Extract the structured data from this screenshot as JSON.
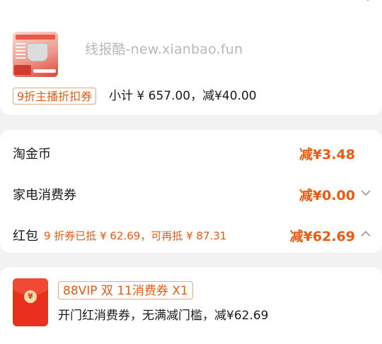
{
  "watermark": "线报酷-new.xianbao.fun",
  "product": {
    "coupon_tag": "9折主播折扣券",
    "subtotal_text": "小计 ¥ 657.00，减¥40.00"
  },
  "discounts": [
    {
      "label": "淘金币",
      "value": "减¥3.48",
      "chevron": "none"
    },
    {
      "label": "家电消费券",
      "value": "减¥0.00",
      "chevron": "down"
    },
    {
      "label": "红包",
      "note": "9 折券已抵 ¥ 62.69，可再抵 ¥ 87.31",
      "value": "减¥62.69",
      "chevron": "up"
    }
  ],
  "red_packet": {
    "icon": "yen-icon",
    "coin_glyph": "¥",
    "title": "88VIP 双 11消费券 X1",
    "description": "开门红消费券，无满减门槛，减¥62.69"
  },
  "colors": {
    "accent": "#ee5a0f",
    "envelope": "#e8301c",
    "background": "#f2f2f2"
  }
}
